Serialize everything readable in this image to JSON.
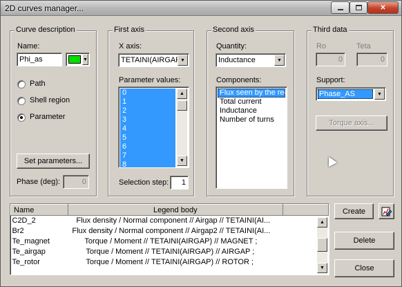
{
  "window": {
    "title": "2D curves manager..."
  },
  "curve_description": {
    "group_title": "Curve description",
    "name_label": "Name:",
    "name_value": "Phi_as",
    "color": "#00e000",
    "radios": [
      {
        "label": "Path",
        "selected": false
      },
      {
        "label": "Shell region",
        "selected": false
      },
      {
        "label": "Parameter",
        "selected": true
      }
    ],
    "set_parameters_button": "Set parameters...",
    "phase_label": "Phase (deg):",
    "phase_value": "0"
  },
  "first_axis": {
    "group_title": "First axis",
    "x_axis_label": "X axis:",
    "x_axis_value": "TETAINI(AIRGAP",
    "parameter_values_label": "Parameter values:",
    "parameter_values": [
      "0",
      "1",
      "2",
      "3",
      "4",
      "5",
      "6",
      "7",
      "8"
    ],
    "selection_step_label": "Selection step:",
    "selection_step_value": "1"
  },
  "second_axis": {
    "group_title": "Second axis",
    "quantity_label": "Quantity:",
    "quantity_value": "Inductance",
    "components_label": "Components:",
    "components": [
      {
        "label": "Flux seen by the regi",
        "selected": true
      },
      {
        "label": "Total current",
        "selected": false
      },
      {
        "label": "Inductance",
        "selected": false
      },
      {
        "label": "Number of turns",
        "selected": false
      }
    ]
  },
  "third_data": {
    "group_title": "Third data",
    "ro_label": "Ro",
    "ro_value": "0",
    "teta_label": "Teta",
    "teta_value": "0",
    "support_label": "Support:",
    "support_value": "Phase_AS",
    "torque_axis_button": "Torque axis..."
  },
  "curves_table": {
    "headers": [
      "Name",
      "Legend body"
    ],
    "rows": [
      {
        "name": "C2D_2",
        "legend": "Flux density / Normal component // Airgap //  TETAINI(AI..."
      },
      {
        "name": "Br2",
        "legend": "Flux density / Normal component // Airgap2 //  TETAINI(AI..."
      },
      {
        "name": "Te_magnet",
        "legend": "Torque / Moment // TETAINI(AIRGAP) // MAGNET ;"
      },
      {
        "name": "Te_airgap",
        "legend": "Torque / Moment // TETAINI(AIRGAP) // AIRGAP ;"
      },
      {
        "name": "Te_rotor",
        "legend": "Torque / Moment // TETAINI(AIRGAP) // ROTOR ;"
      }
    ]
  },
  "buttons": {
    "create": "Create",
    "delete": "Delete",
    "close": "Close"
  },
  "icons": {
    "curve_editor": "curve-edit-icon"
  }
}
